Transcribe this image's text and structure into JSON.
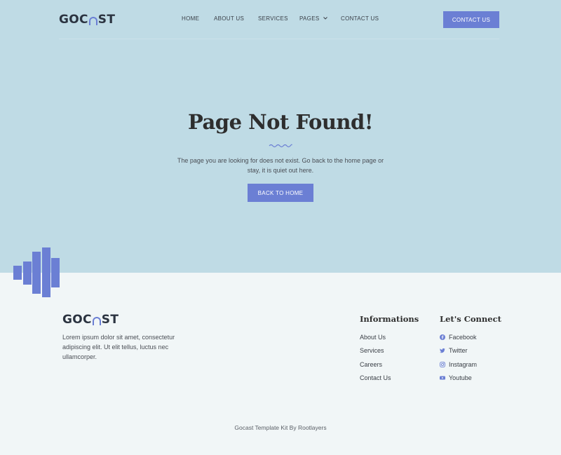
{
  "brand": {
    "logo_left": "GOC",
    "logo_right": "ST",
    "accent_color": "#6b7fd4"
  },
  "nav": {
    "home": "HOME",
    "about": "ABOUT US",
    "services": "SERVICES",
    "pages": "PAGES",
    "contact": "CONTACT US",
    "cta": "CONTACT US"
  },
  "hero": {
    "title": "Page Not Found!",
    "description": "The page you are looking for does not exist. Go back to the home page or stay, it is quiet out here.",
    "button": "BACK TO HOME"
  },
  "footer": {
    "description": "Lorem ipsum dolor sit amet, consectetur adipiscing elit. Ut elit tellus, luctus nec ullamcorper.",
    "informations_title": "Informations",
    "informations": [
      "About Us",
      "Services",
      "Careers",
      "Contact Us"
    ],
    "connect_title": "Let's Connect",
    "connect": [
      {
        "label": "Facebook",
        "icon": "facebook-icon"
      },
      {
        "label": "Twitter",
        "icon": "twitter-icon"
      },
      {
        "label": "Instagram",
        "icon": "instagram-icon"
      },
      {
        "label": "Youtube",
        "icon": "youtube-icon"
      }
    ],
    "copyright": "Gocast Template Kit By Rootlayers"
  }
}
